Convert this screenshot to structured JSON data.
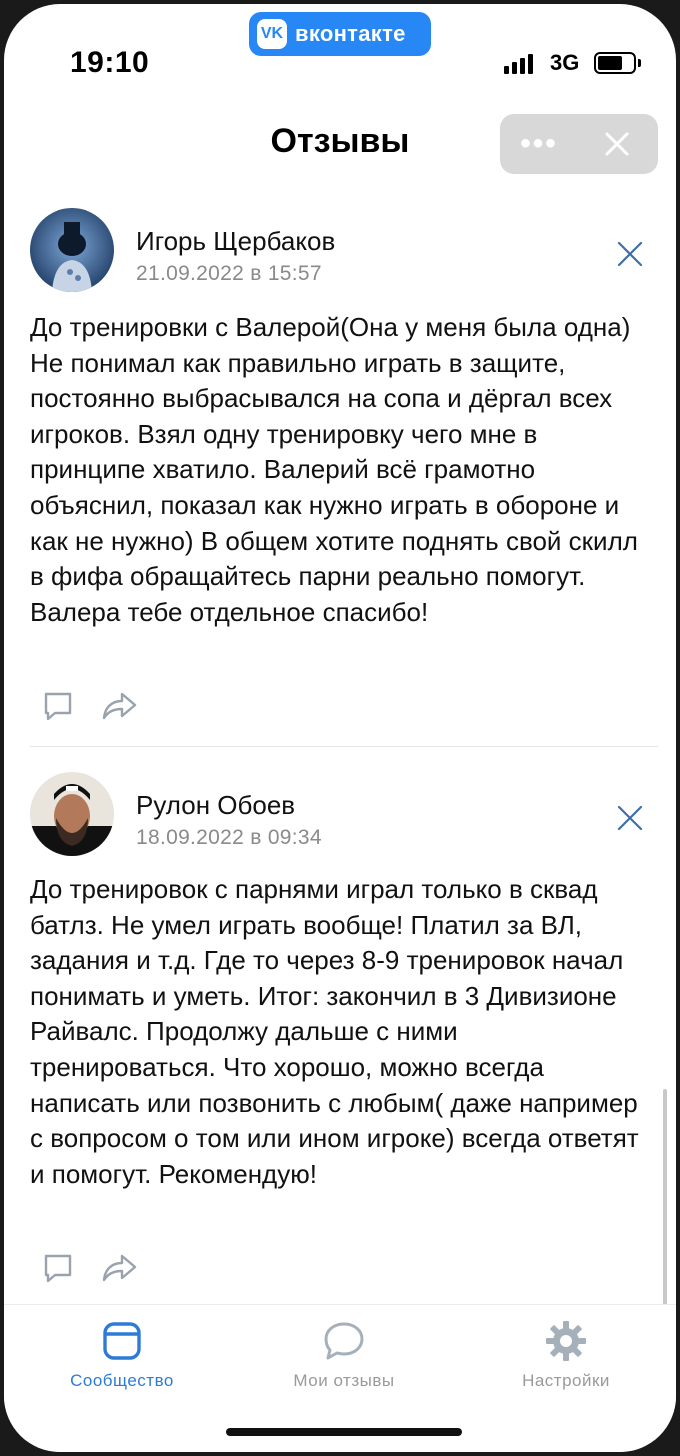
{
  "status_bar": {
    "time": "19:10",
    "app_badge": "вконтакте",
    "app_badge_logo": "vk",
    "network": "3G"
  },
  "header": {
    "title": "Отзывы",
    "more_label": "•••"
  },
  "reviews": [
    {
      "author": "Игорь Щербаков",
      "date": "21.09.2022 в 15:57",
      "text": "До тренировки с Валерой(Она у меня была одна) Не понимал как правильно играть в защите, постоянно выбрасывался на сопа и дёргал всех игроков. Взял одну тренировку чего мне в принципе хватило. Валерий всё грамотно объяснил, показал как нужно играть в обороне и как не нужно) В общем хотите поднять свой скилл в фифа обращайтесь парни реально помогут. Валера тебе отдельное спасибо!"
    },
    {
      "author": "Рулон Обоев",
      "date": "18.09.2022 в 09:34",
      "text": "До тренировок с парнями играл только в сквад батлз. Не умел играть вообще! Платил за ВЛ, задания и т.д. Где то через 8-9 тренировок начал понимать и уметь. Итог: закончил в 3 Дивизионе Райвалс. Продолжу дальше с ними тренироваться. Что хорошо, можно всегда написать или позвонить с любым( даже например с вопросом о том или ином игроке) всегда ответят и помогут. Рекомендую!"
    }
  ],
  "tabs": [
    {
      "label": "Сообщество",
      "icon": "community-icon",
      "active": true
    },
    {
      "label": "Мои отзывы",
      "icon": "speech-bubble-icon",
      "active": false
    },
    {
      "label": "Настройки",
      "icon": "gear-icon",
      "active": false
    }
  ],
  "colors": {
    "accent": "#2e7bd6",
    "vk_blue": "#2787f5",
    "muted_text": "#8a8a8a",
    "icon_gray": "#9aa3ad"
  }
}
